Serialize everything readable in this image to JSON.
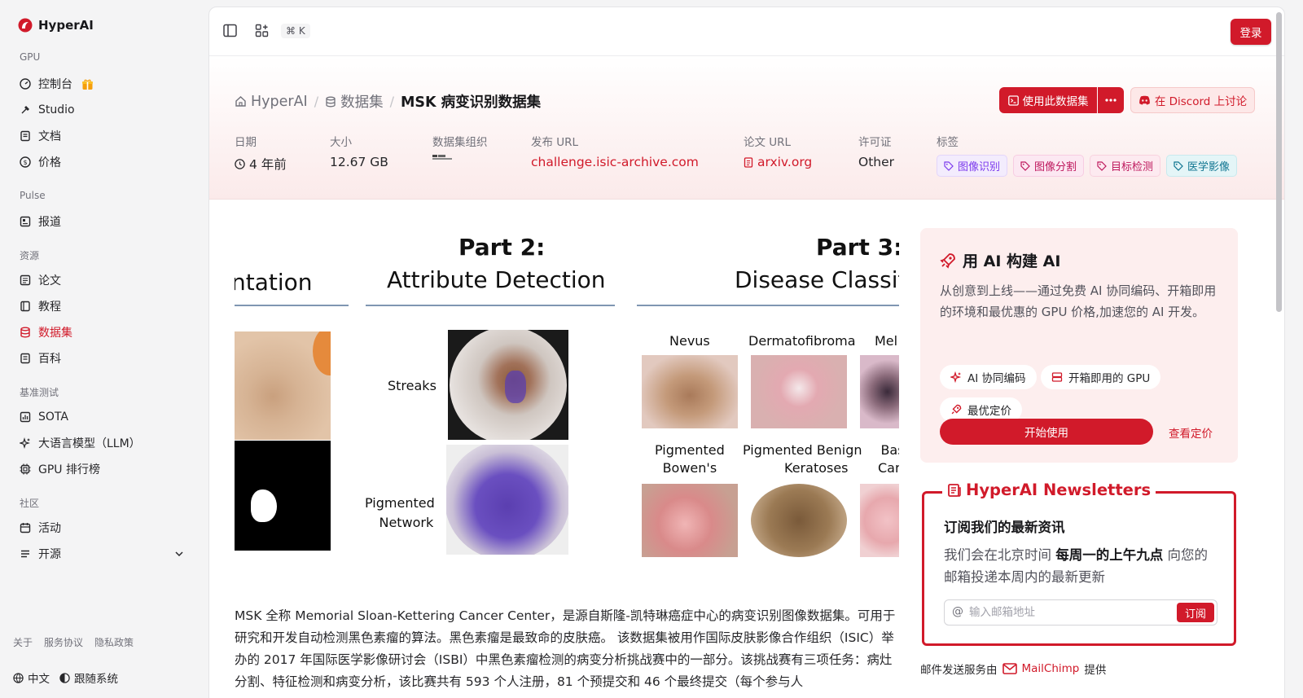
{
  "brand": {
    "name": "HyperAI"
  },
  "sidebar": {
    "sections": [
      {
        "label": "GPU"
      },
      {
        "label": "Pulse"
      },
      {
        "label": "资源"
      },
      {
        "label": "基准测试"
      },
      {
        "label": "社区"
      }
    ],
    "items": [
      {
        "label": "控制台",
        "icon": "dashboard-icon"
      },
      {
        "label": "Studio",
        "icon": "studio-icon"
      },
      {
        "label": "文档",
        "icon": "document-icon"
      },
      {
        "label": "价格",
        "icon": "dollar-icon"
      },
      {
        "label": "报道",
        "icon": "news-icon"
      },
      {
        "label": "论文",
        "icon": "paper-icon"
      },
      {
        "label": "教程",
        "icon": "tutorial-icon"
      },
      {
        "label": "数据集",
        "icon": "database-icon",
        "active": true
      },
      {
        "label": "百科",
        "icon": "wiki-icon"
      },
      {
        "label": "SOTA",
        "icon": "chart-icon"
      },
      {
        "label": "大语言模型（LLM）",
        "icon": "sparkle-icon"
      },
      {
        "label": "GPU 排行榜",
        "icon": "cpu-icon"
      },
      {
        "label": "活动",
        "icon": "calendar-icon"
      },
      {
        "label": "开源",
        "icon": "open-source-icon"
      }
    ],
    "footer_links": [
      "关于",
      "服务协议",
      "隐私政策"
    ],
    "language": "中文",
    "theme": "跟随系统"
  },
  "topbar": {
    "shortcut": "⌘ K",
    "login": "登录"
  },
  "breadcrumb": {
    "home": "HyperAI",
    "section": "数据集",
    "current": "MSK 病变识别数据集"
  },
  "actions": {
    "use_dataset": "使用此数据集",
    "discord": "在 Discord 上讨论"
  },
  "meta": {
    "date_label": "日期",
    "date_value": "4 年前",
    "size_label": "大小",
    "size_value": "12.67 GB",
    "org_label": "数据集组织",
    "url_label": "发布 URL",
    "url_value": "challenge.isic-archive.com",
    "paper_label": "论文 URL",
    "paper_value": "arxiv.org",
    "license_label": "许可证",
    "license_value": "Other",
    "tags_label": "标签",
    "tags": [
      {
        "label": "图像识别",
        "color": "#7c3aed",
        "bg": "#f3ecfd",
        "border": "#e3d5fb"
      },
      {
        "label": "图像分割",
        "color": "#be185d",
        "bg": "#fce8f2",
        "border": "#f7cde2"
      },
      {
        "label": "目标检测",
        "color": "#be185d",
        "bg": "#fdeaf0",
        "border": "#f8d2df"
      },
      {
        "label": "医学影像",
        "color": "#0e7490",
        "bg": "#e4f5f7",
        "border": "#c8eaee"
      }
    ]
  },
  "figure": {
    "seg_title": "ntation",
    "part2": "Part 2:",
    "part2_sub": "Attribute Detection",
    "part3": "Part 3:",
    "part3_sub": "Disease Classif",
    "streaks": "Streaks",
    "pigmented": "Pigmented",
    "network": "Network",
    "nevus": "Nevus",
    "dermatofibroma": "Dermatofibroma",
    "mel": "Mel",
    "bowen1": "Pigmented",
    "bowen2": "Bowen's",
    "benign1": "Pigmented Benign",
    "benign2": "Keratoses",
    "bas1": "Bas",
    "bas2": "Carc"
  },
  "description": "MSK 全称 Memorial Sloan-Kettering Cancer Center，是源自斯隆-凯特琳癌症中心的病变识别图像数据集。可用于研究和开发自动检测黑色素瘤的算法。黑色素瘤是最致命的皮肤癌。 该数据集被用作国际皮肤影像合作组织（ISIC）举办的 2017 年国际医学影像研讨会（ISBI）中黑色素瘤检测的病变分析挑战赛中的一部分。该挑战赛有三项任务：病灶分割、特征检测和病变分析，该比赛共有 593 个人注册，81 个预提交和 46 个最终提交（每个参与人",
  "promo": {
    "title": "用 AI 构建 AI",
    "desc": "从创意到上线——通过免费 AI 协同编码、开箱即用的环境和最优惠的 GPU 价格,加速您的 AI 开发。",
    "chips": [
      "AI 协同编码",
      "开箱即用的 GPU",
      "最优定价"
    ],
    "start": "开始使用",
    "pricing": "查看定价"
  },
  "newsletter": {
    "title": "HyperAI Newsletters",
    "subtitle": "订阅我们的最新资讯",
    "desc_pre": "我们会在北京时间",
    "desc_bold": "每周一的上午九点",
    "desc_post": "向您的邮箱投递本周内的最新更新",
    "placeholder": "输入邮箱地址",
    "subscribe": "订阅",
    "credit_pre": "邮件发送服务由",
    "credit_brand": "MailChimp",
    "credit_post": "提供"
  },
  "colors": {
    "accent": "#d11a2a"
  }
}
